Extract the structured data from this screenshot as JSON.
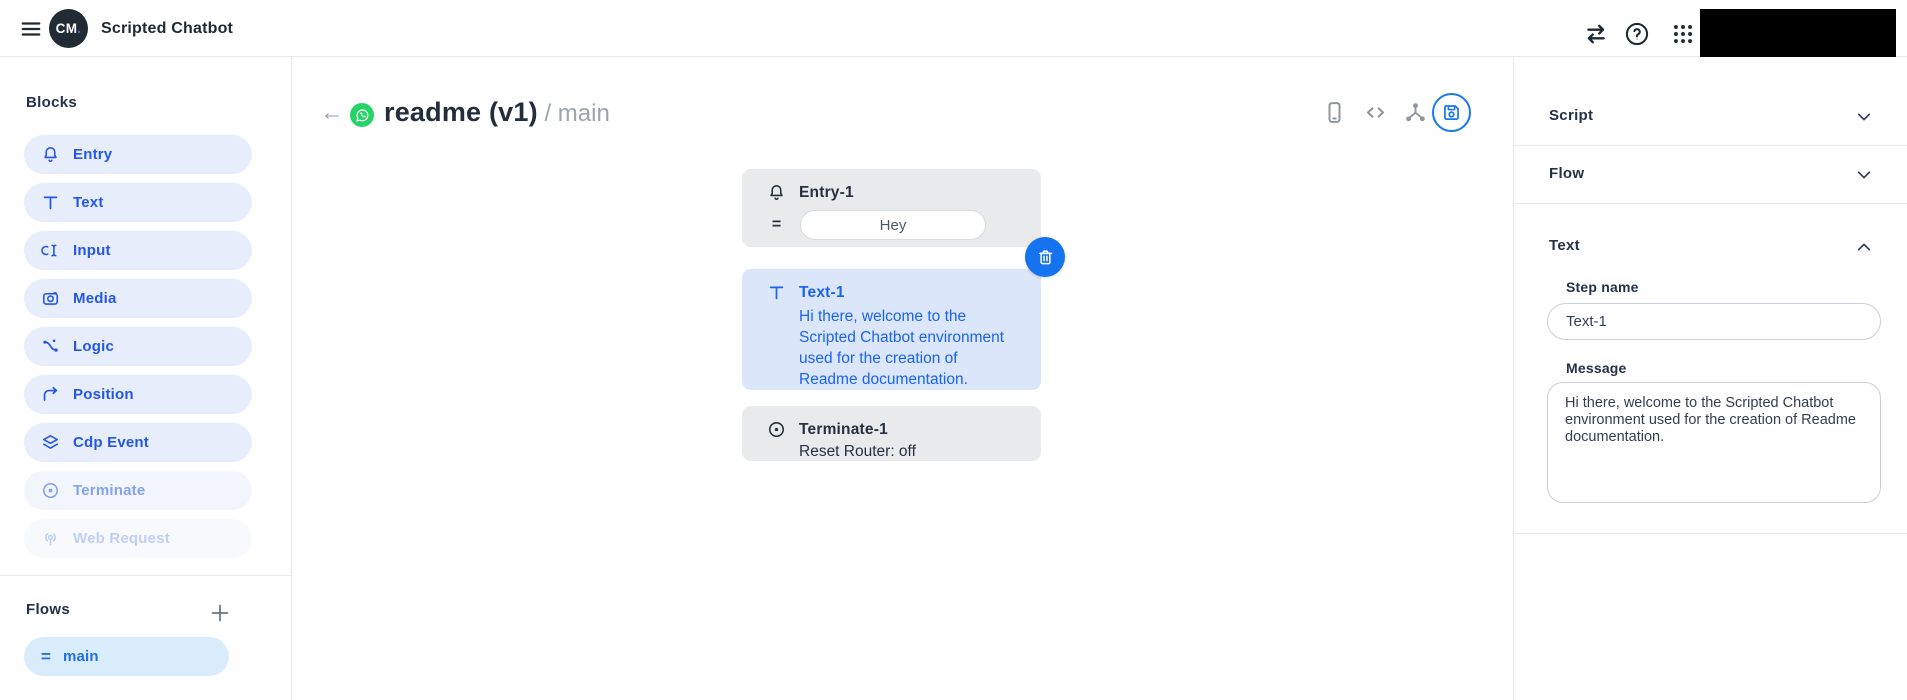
{
  "topbar": {
    "logo_text": "CM",
    "logo_dot": ".",
    "app_title": "Scripted Chatbot"
  },
  "sidebar": {
    "blocks_title": "Blocks",
    "blocks": [
      {
        "label": "Entry",
        "icon": "bell-icon"
      },
      {
        "label": "Text",
        "icon": "text-icon"
      },
      {
        "label": "Input",
        "icon": "input-cursor-icon"
      },
      {
        "label": "Media",
        "icon": "camera-icon"
      },
      {
        "label": "Logic",
        "icon": "branch-icon"
      },
      {
        "label": "Position",
        "icon": "curved-arrow-icon"
      },
      {
        "label": "Cdp Event",
        "icon": "layers-icon"
      },
      {
        "label": "Terminate",
        "icon": "record-icon"
      },
      {
        "label": "Web Request",
        "icon": "broadcast-icon"
      }
    ],
    "flows_title": "Flows",
    "flows": [
      {
        "label": "main"
      }
    ]
  },
  "canvas": {
    "breadcrumb": {
      "title": "readme (v1)",
      "separator": " / ",
      "flow": "main"
    },
    "nodes": {
      "entry": {
        "title": "Entry-1",
        "operator": "=",
        "keyword": "Hey"
      },
      "text": {
        "title": "Text-1",
        "message": "Hi there, welcome to the Scripted Chatbot environment used for the creation of Readme documentation."
      },
      "terminate": {
        "title": "Terminate-1",
        "subtitle": "Reset Router: off"
      }
    }
  },
  "inspector": {
    "sections": [
      {
        "label": "Script",
        "expanded": false
      },
      {
        "label": "Flow",
        "expanded": false
      },
      {
        "label": "Text",
        "expanded": true
      }
    ],
    "step_name_label": "Step name",
    "step_name_value": "Text-1",
    "message_label": "Message",
    "message_value": "Hi there, welcome to the Scripted Chatbot environment used for the creation of Readme documentation."
  },
  "colors": {
    "accent_blue": "#1673f0",
    "pill_blue_bg": "#e8edfb",
    "flow_pill_bg": "#d9ecfb",
    "node_gray_bg": "#e9eaec",
    "node_blue_bg": "#dbe6fa",
    "whatsapp_green": "#25d366",
    "dark_text": "#25304a"
  }
}
